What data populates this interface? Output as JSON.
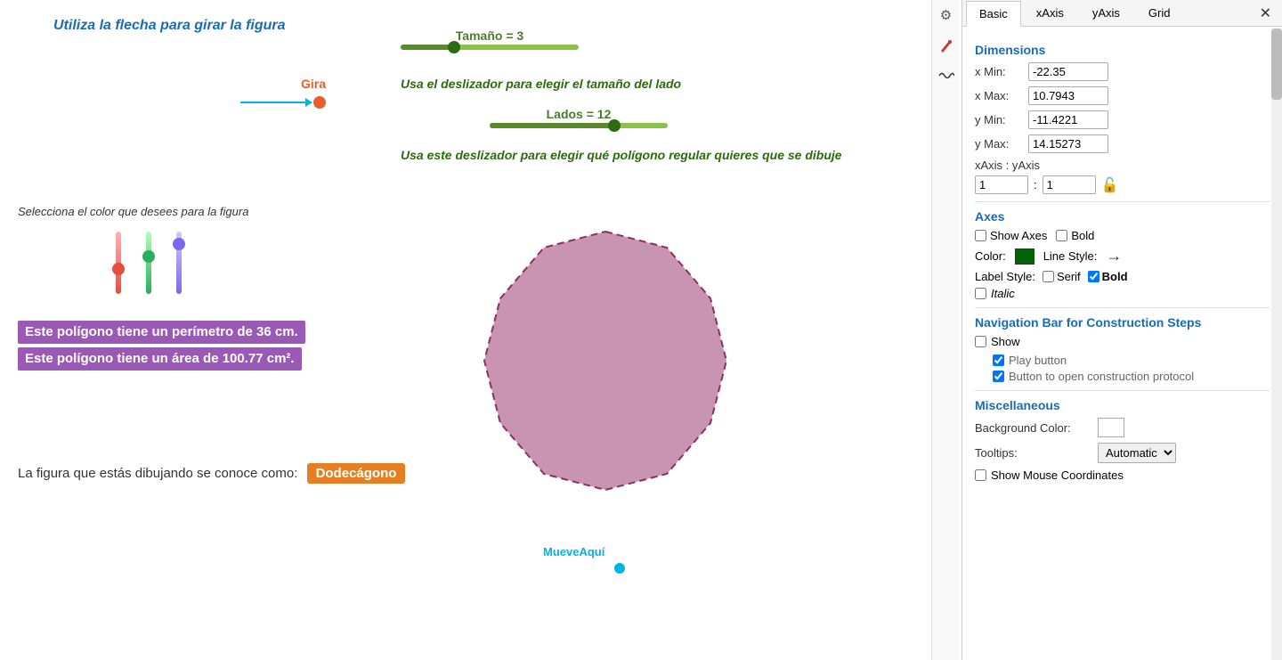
{
  "title": "Utiliza la flecha para girar la figura",
  "tabs": {
    "items": [
      {
        "label": "Basic",
        "active": true
      },
      {
        "label": "xAxis",
        "active": false
      },
      {
        "label": "yAxis",
        "active": false
      },
      {
        "label": "Grid",
        "active": false
      }
    ],
    "close_icon": "✕"
  },
  "sliders": {
    "tamano": {
      "label": "Tamaño = 3",
      "value": 3,
      "percent": 30
    },
    "lados": {
      "label": "Lados = 12",
      "value": 12,
      "percent": 70
    },
    "tamano_hint": "Usa el deslizador para elegir el tamaño del lado",
    "lados_hint": "Usa este deslizador para elegir qué polígono regular quieres que se dibuje"
  },
  "rotation": {
    "gira_label": "Gira"
  },
  "color_section": {
    "label": "Selecciona el color que desees para la figura",
    "colors": [
      "#e74c3c",
      "#27ae60",
      "#7b68ee"
    ]
  },
  "polygon": {
    "perimeter_text": "Este polígono tiene un perímetro de 36 cm.",
    "area_text": "Este polígono tiene un área de 100.77 cm².",
    "figure_prefix": "La figura que estás dibujando se conoce como:",
    "figure_name": "Dodecágono"
  },
  "mueveaqui": "MueveAquí",
  "dimensions": {
    "title": "Dimensions",
    "x_min_label": "x Min:",
    "x_min_value": "-22.35",
    "x_max_label": "x Max:",
    "x_max_value": "10.7943",
    "y_min_label": "y Min:",
    "y_min_value": "-11.4221",
    "y_max_label": "y Max:",
    "y_max_value": "14.15273",
    "xaxis_yaxis_label": "xAxis : yAxis",
    "ratio_x": "1",
    "ratio_y": "1"
  },
  "axes": {
    "title": "Axes",
    "show_axes_label": "Show Axes",
    "bold_label": "Bold",
    "color_label": "Color:",
    "line_style_label": "Line Style:",
    "label_style_label": "Label Style:",
    "serif_label": "Serif",
    "bold_label2": "Bold",
    "italic_label": "Italic"
  },
  "nav_bar": {
    "title": "Navigation Bar for Construction Steps",
    "show_label": "Show",
    "play_button_label": "Play button",
    "button_open_label": "Button to open construction protocol"
  },
  "miscellaneous": {
    "title": "Miscellaneous",
    "bg_color_label": "Background Color:",
    "tooltips_label": "Tooltips:",
    "tooltips_value": "Automatic",
    "show_mouse_label": "Show Mouse Coordinates"
  },
  "play_button": {
    "label": "button Play"
  }
}
